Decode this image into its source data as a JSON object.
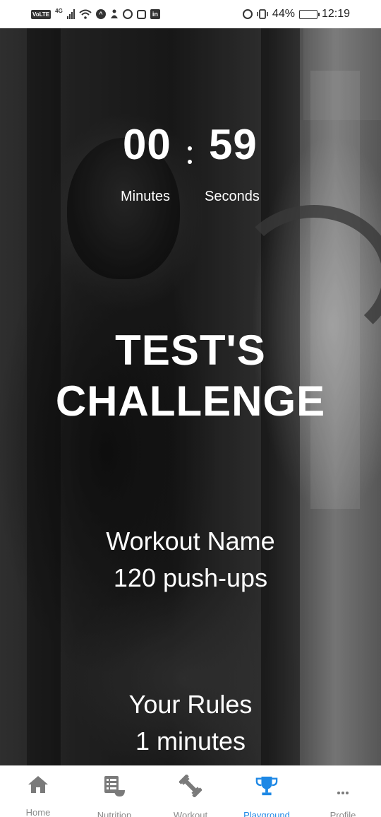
{
  "status_bar": {
    "volte": "VoLTE",
    "network": "4G",
    "battery_percent": "44%",
    "battery_level": 0.44,
    "time": "12:19",
    "left_icons": [
      "volte-icon",
      "signal-icon",
      "wifi-icon",
      "app-icon",
      "notification-icon",
      "whatsapp-icon",
      "instagram-icon",
      "linkedin-icon"
    ],
    "right_icons": [
      "alarm-icon",
      "vibrate-icon",
      "battery-icon"
    ]
  },
  "timer": {
    "minutes": "00",
    "seconds": "59",
    "minutes_label": "Minutes",
    "seconds_label": "Seconds"
  },
  "challenge": {
    "title_line1": "TEST'S",
    "title_line2": "CHALLENGE",
    "workout_label": "Workout Name",
    "workout_value": "120 push-ups",
    "rules_label": "Your Rules",
    "rules_value": "1 minutes"
  },
  "bottom_nav": {
    "active_color": "#1e88e5",
    "inactive_color": "#8a8a8a",
    "items": [
      {
        "label": "Home",
        "icon": "home-icon"
      },
      {
        "label": "Nutrition",
        "icon": "nutrition-icon"
      },
      {
        "label": "Workout",
        "icon": "dumbbell-icon"
      },
      {
        "label": "Playground",
        "icon": "trophy-icon",
        "active": true
      },
      {
        "label": "Profile",
        "icon": "more-icon"
      }
    ]
  }
}
